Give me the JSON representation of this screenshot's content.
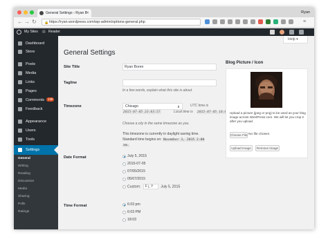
{
  "browser": {
    "tab_title": "General Settings ‹ Ryan B",
    "profile_name": "Ryan",
    "url": "https://ryan.wordpress.com/wp-admin/options-general.php",
    "url_lock": "🔒"
  },
  "adminbar": {
    "my_sites": "My Sites",
    "reader": "Reader"
  },
  "sidebar": {
    "items": [
      {
        "label": "Dashboard"
      },
      {
        "label": "Store"
      },
      {
        "label": "Posts"
      },
      {
        "label": "Media"
      },
      {
        "label": "Links"
      },
      {
        "label": "Pages"
      },
      {
        "label": "Comments",
        "badge": "136"
      },
      {
        "label": "Feedback"
      },
      {
        "label": "Appearance"
      },
      {
        "label": "Users"
      },
      {
        "label": "Tools"
      },
      {
        "label": "Settings"
      }
    ],
    "submenu": [
      "General",
      "Writing",
      "Reading",
      "Discussion",
      "Media",
      "Sharing",
      "Polls",
      "Ratings"
    ]
  },
  "help": {
    "label": "Help ▾"
  },
  "page": {
    "title": "General Settings"
  },
  "form": {
    "site_title": {
      "label": "Site Title",
      "value": "Ryan Boren"
    },
    "tagline": {
      "label": "Tagline",
      "value": "",
      "description": "In a few words, explain what this site is about."
    },
    "timezone": {
      "label": "Timezone",
      "selected": "Chicago",
      "utc_label": "UTC time is",
      "utc_time": "2015-07-05 23:03:57",
      "local_label": "Local time is",
      "local_time": "2015-07-05 18:03:57",
      "description": "Choose a city in the same timezone as you.",
      "dst_line1": "This timezone is currently in daylight saving time.",
      "dst_line2": "Standard time begins on:",
      "dst_date": "November 1, 2015 2:00",
      "dst_am": "am."
    },
    "date_format": {
      "label": "Date Format",
      "options": [
        "July 5, 2015",
        "2015-07-05",
        "07/05/2015",
        "05/07/2015"
      ],
      "selected_index": 0,
      "custom_label": "Custom:",
      "custom_value": "F j, Y",
      "custom_preview": "July 5, 2015"
    },
    "time_format": {
      "label": "Time Format",
      "options": [
        "6:03 pm",
        "6:03 PM",
        "18:03"
      ],
      "selected_index": 0
    }
  },
  "blog_picture": {
    "title": "Blog Picture / Icon",
    "text": "Upload a picture (jpeg or png) to be used as your blog image across WordPress.com. We will let you crop it after you upload.",
    "choose_file": "Choose File",
    "no_file": "No file chosen",
    "upload": "Upload Image",
    "remove": "Remove Image"
  },
  "colors": {
    "admin_dark": "#23282d",
    "accent": "#0073aa",
    "submenu_bg": "#32373c",
    "badge": "#d54e21"
  }
}
